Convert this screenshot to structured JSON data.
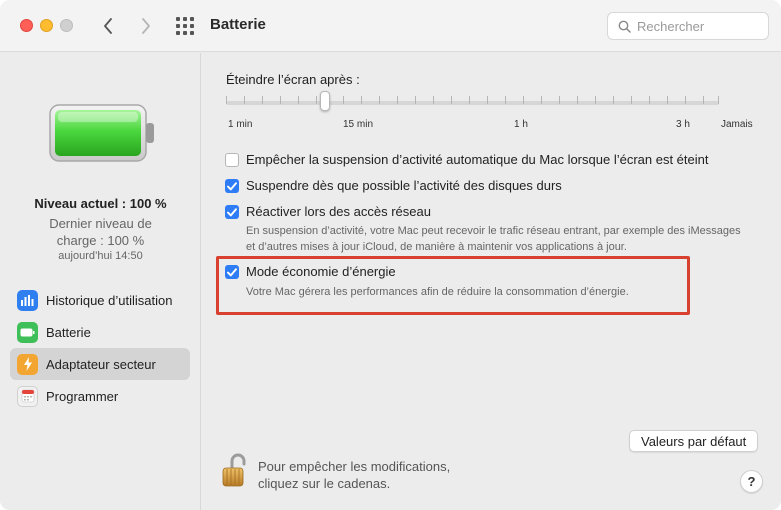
{
  "window": {
    "title": "Batterie",
    "search_placeholder": "Rechercher"
  },
  "sidebar": {
    "level_main": "Niveau actuel : 100 %",
    "level_sub": "Dernier niveau de charge : 100 %",
    "level_time": "aujourd’hui 14:50",
    "battery_charge": 1.0,
    "items": [
      {
        "label": "Historique d’utilisation",
        "icon": "usage-history-icon",
        "color": "#2f7ff0",
        "active": false
      },
      {
        "label": "Batterie",
        "icon": "battery-icon",
        "color": "#3fbf57",
        "active": false
      },
      {
        "label": "Adaptateur secteur",
        "icon": "power-adapter-icon",
        "color": "#f3a532",
        "active": true
      },
      {
        "label": "Programmer",
        "icon": "calendar-icon",
        "color": "#e8e8e8",
        "active": false
      }
    ]
  },
  "main": {
    "slider_label": "Éteindre l’écran après :",
    "slider_value": "15 min",
    "slider_ticks": [
      "1 min",
      "15 min",
      "1 h",
      "3 h",
      "Jamais"
    ],
    "options": [
      {
        "label": "Empêcher la suspension d’activité automatique du Mac lorsque l’écran est éteint",
        "checked": false
      },
      {
        "label": "Suspendre dès que possible l’activité des disques durs",
        "checked": true
      },
      {
        "label": "Réactiver lors des accès réseau",
        "checked": true,
        "description": "En suspension d’activité, votre Mac peut recevoir le trafic réseau entrant, par exemple des iMessages et d’autres mises à jour iCloud, de manière à maintenir vos applications à jour."
      },
      {
        "label": "Mode économie d’énergie",
        "checked": true,
        "description": "Votre Mac gérera les performances afin de réduire la consommation d’énergie."
      }
    ],
    "default_button": "Valeurs par défaut",
    "lock_text_line1": "Pour empêcher les modifications,",
    "lock_text_line2": "cliquez sur le cadenas.",
    "help_label": "?"
  },
  "colors": {
    "accent": "#2e7cf6",
    "highlight": "#d8402f",
    "battery_green": "#3fc93a"
  }
}
